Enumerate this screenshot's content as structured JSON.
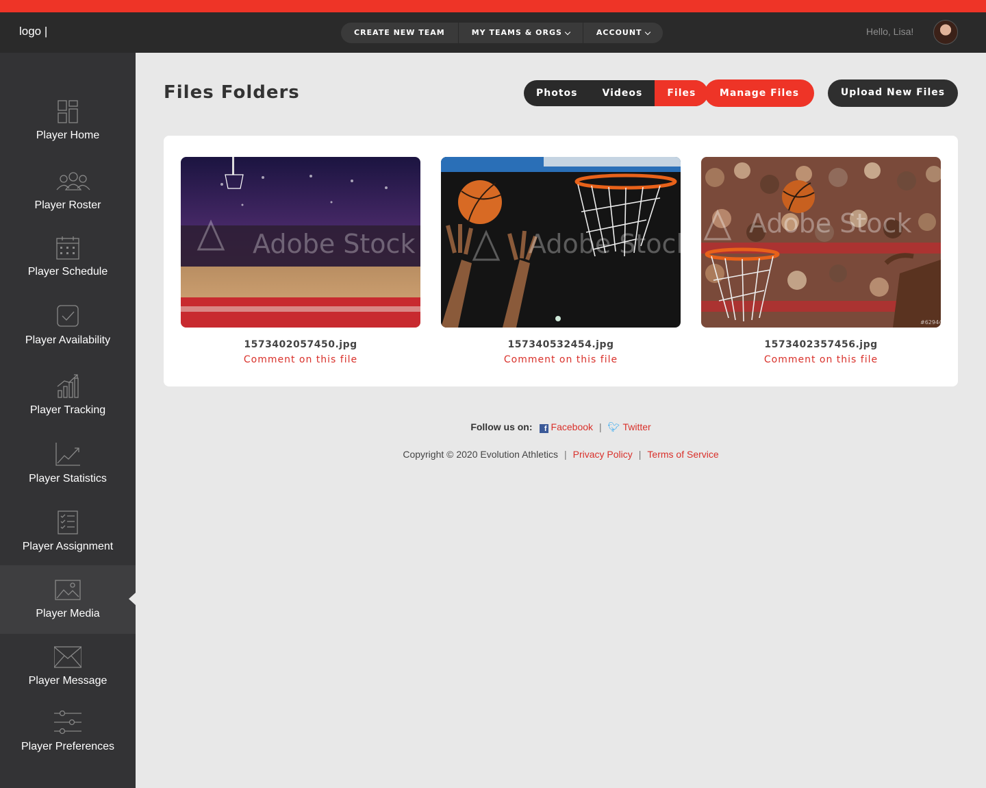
{
  "header": {
    "logo": "logo |",
    "nav": [
      {
        "label": "CREATE NEW TEAM",
        "dropdown": false
      },
      {
        "label": "MY TEAMS & ORGS",
        "dropdown": true
      },
      {
        "label": "ACCOUNT",
        "dropdown": true
      }
    ],
    "greeting": "Hello, Lisa!"
  },
  "sidebar": {
    "items": [
      {
        "label": "Player Home",
        "icon": "dashboard-icon"
      },
      {
        "label": "Player Roster",
        "icon": "group-icon"
      },
      {
        "label": "Player Schedule",
        "icon": "calendar-icon"
      },
      {
        "label": "Player Availability",
        "icon": "checkbox-icon"
      },
      {
        "label": "Player Tracking",
        "icon": "bar-growth-icon"
      },
      {
        "label": "Player Statistics",
        "icon": "trend-icon"
      },
      {
        "label": "Player Assignment",
        "icon": "checklist-icon"
      },
      {
        "label": "Player Media",
        "icon": "image-icon",
        "active": true
      },
      {
        "label": "Player Message",
        "icon": "envelope-icon"
      },
      {
        "label": "Player Preferences",
        "icon": "sliders-icon"
      }
    ]
  },
  "main": {
    "title": "Files Folders",
    "tabs": [
      {
        "label": "Photos"
      },
      {
        "label": "Videos"
      },
      {
        "label": "Files",
        "active": true
      }
    ],
    "manage_label": "Manage Files",
    "upload_label": "Upload New Files",
    "files": [
      {
        "name": "1573402057450.jpg",
        "comment": "Comment on this file",
        "watermark": "Adobe Stock"
      },
      {
        "name": "157340532454.jpg",
        "comment": "Comment on this file",
        "watermark": "Adobe Stock"
      },
      {
        "name": "1573402357456.jpg",
        "comment": "Comment on this file",
        "watermark": "Adobe Stock",
        "tag": "#62944"
      }
    ]
  },
  "footer": {
    "follow": "Follow us on:",
    "facebook": "Facebook",
    "twitter": "Twitter",
    "copyright": "Copyright © 2020 Evolution Athletics",
    "privacy": "Privacy Policy",
    "terms": "Terms of Service"
  },
  "colors": {
    "accent": "#ee3427",
    "dark": "#2a2a2a",
    "sidebar": "#333335",
    "background": "#e8e8e8"
  }
}
